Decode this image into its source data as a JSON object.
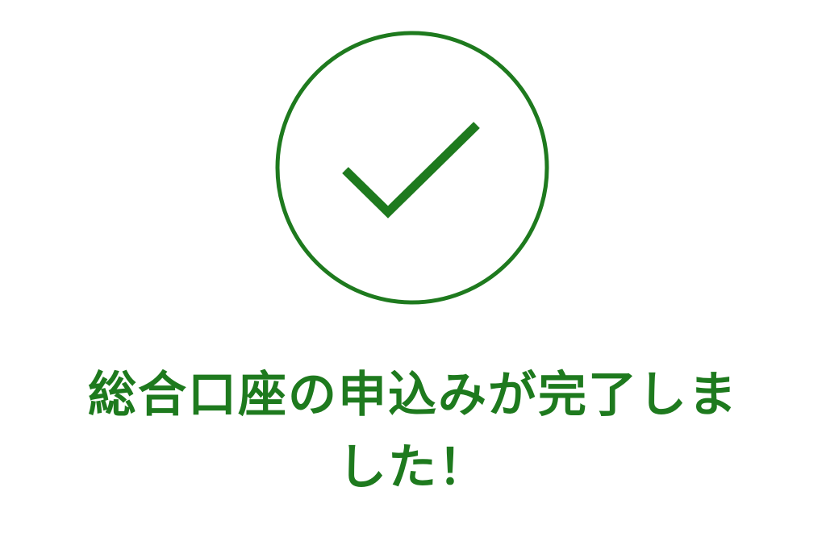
{
  "status": {
    "icon": "checkmark-circle-icon",
    "color": "#1e7a1e"
  },
  "message": {
    "line1": "総合口座の申込みが完了しま",
    "line2": "した！"
  }
}
